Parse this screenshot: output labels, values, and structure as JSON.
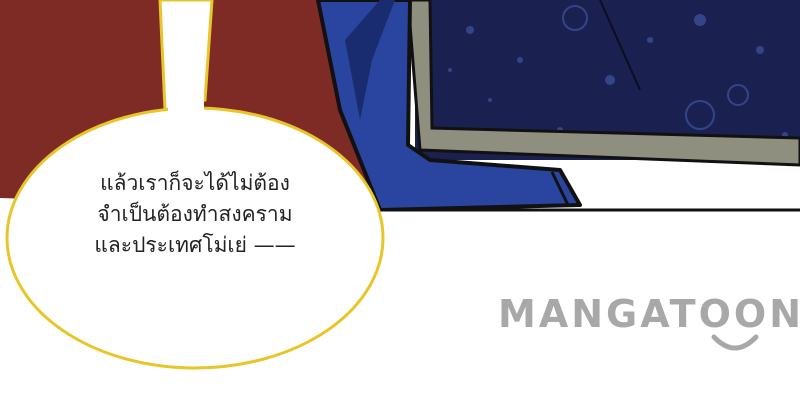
{
  "speech_bubble": {
    "lines": [
      "แล้วเราก็จะได้ไม่ต้อง",
      "จำเป็นต้องทำสงคราม",
      "และประเทศโม่เย่ ——"
    ]
  },
  "watermark": {
    "text": "MANGATOON"
  },
  "colors": {
    "wall": "#7e2b26",
    "night_sky": "#1a2150",
    "robe_blue": "#2a45a0",
    "frame_gray": "#8f8f80",
    "bubble_border": "#e8c62a",
    "watermark": "#a8a8a8"
  }
}
